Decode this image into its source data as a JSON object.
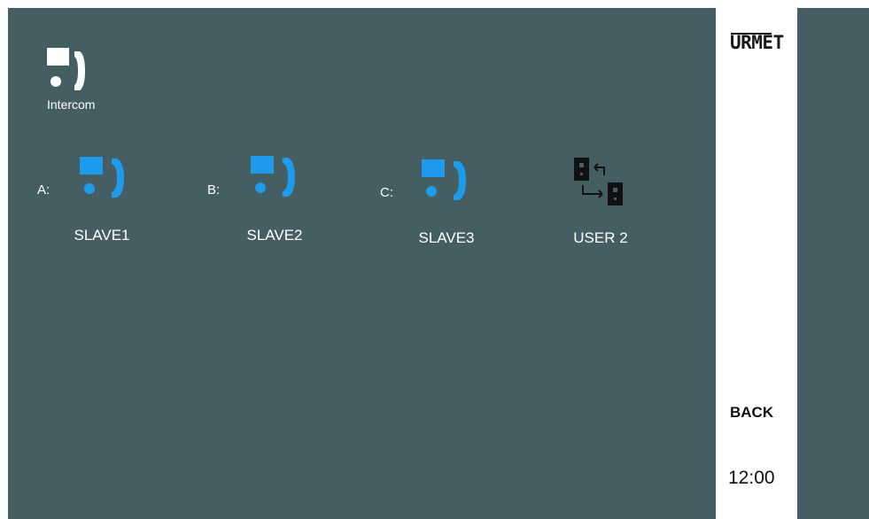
{
  "header": {
    "title": "Intercom",
    "title_icon": "intercom-handset-icon"
  },
  "slots": [
    {
      "letter": "A:",
      "name": "SLAVE1",
      "icon": "intercom-handset-icon"
    },
    {
      "letter": "B:",
      "name": "SLAVE2",
      "icon": "intercom-handset-icon"
    },
    {
      "letter": "C:",
      "name": "SLAVE3",
      "icon": "intercom-handset-icon"
    }
  ],
  "user_switch": {
    "name": "USER 2",
    "icon": "user-switch-icon"
  },
  "sidebar": {
    "brand": "URMET",
    "back_label": "BACK",
    "time": "12:00"
  },
  "colors": {
    "background": "#445e63",
    "accent": "#1e9bea",
    "sidebar": "#ffffff"
  }
}
